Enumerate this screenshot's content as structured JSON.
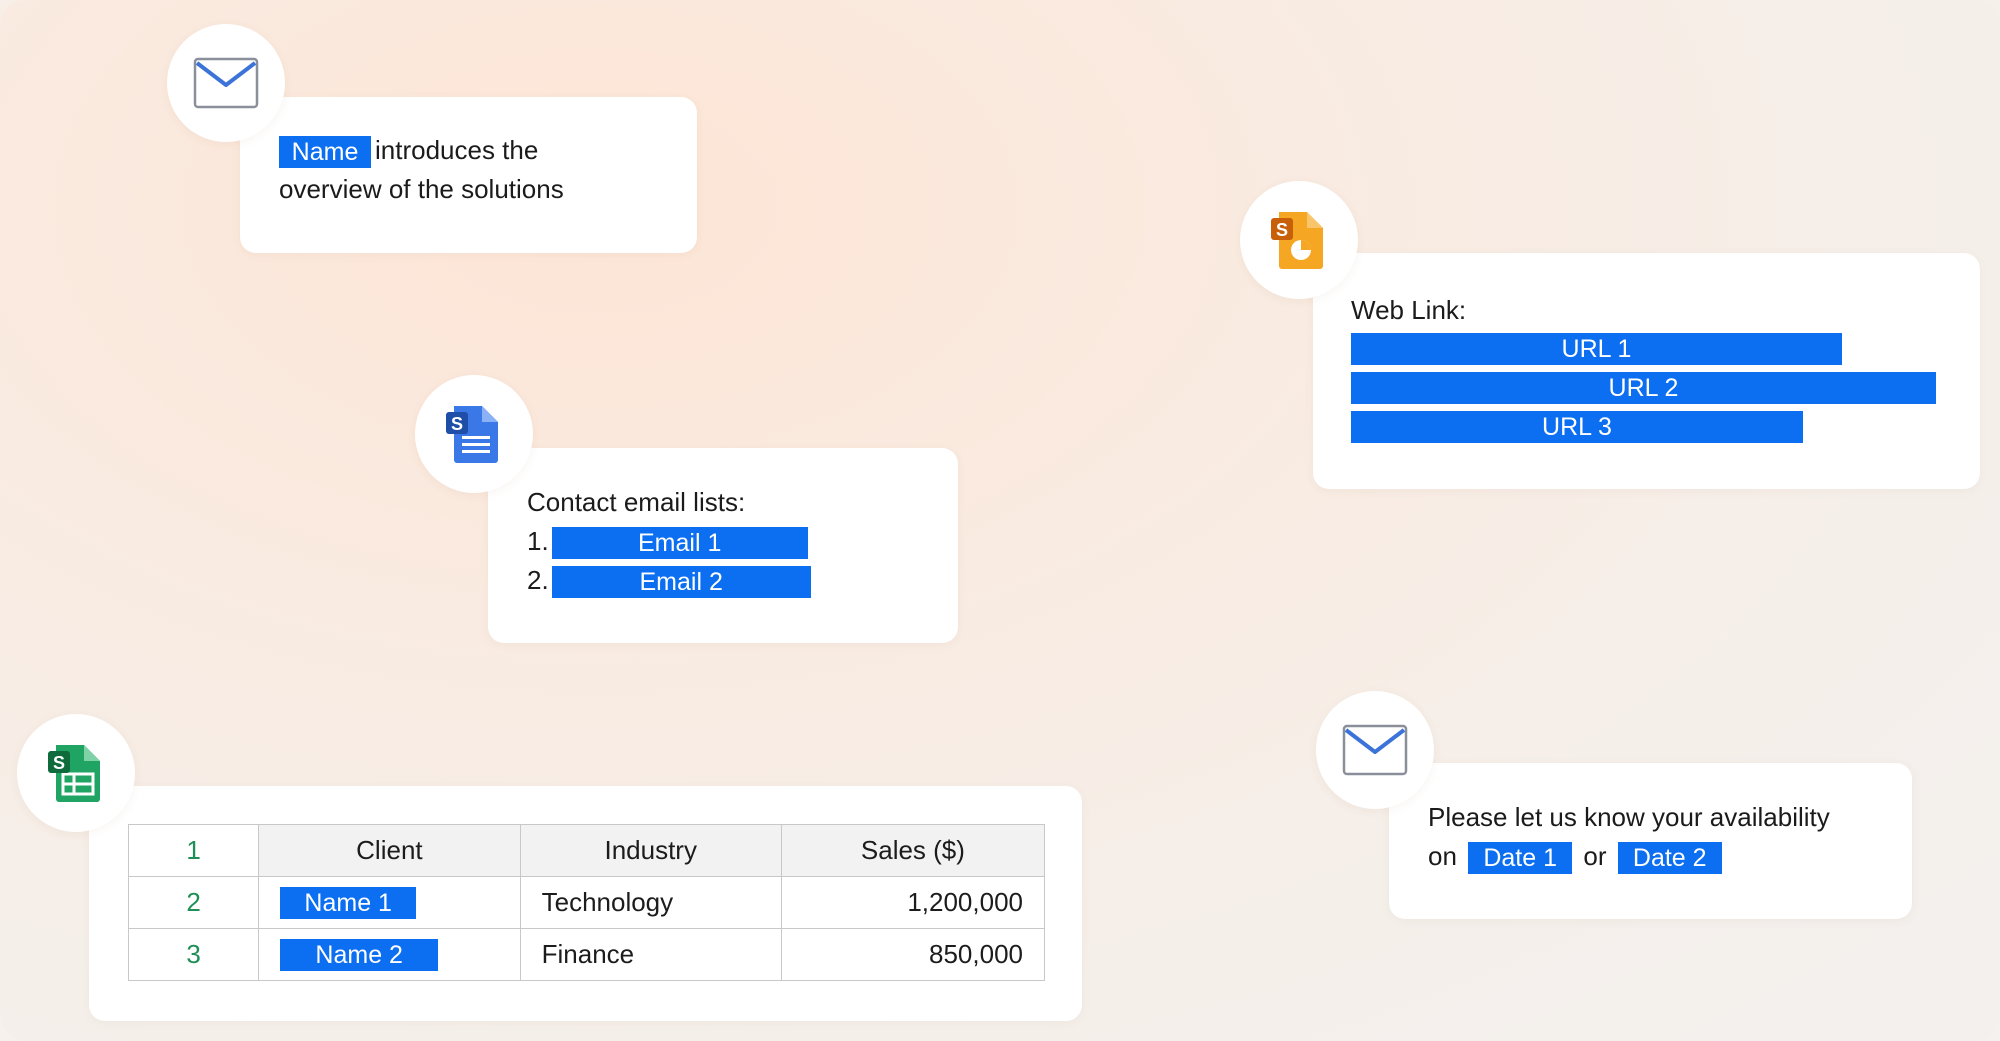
{
  "card_intro": {
    "highlight": "Name",
    "text_line1": "introduces the",
    "text_line2": "overview of the solutions"
  },
  "card_web": {
    "label": "Web Link:",
    "links": [
      "URL 1",
      "URL 2",
      "URL 3"
    ]
  },
  "card_contacts": {
    "label": "Contact email lists:",
    "items": [
      {
        "number": "1.",
        "value": "Email 1"
      },
      {
        "number": "2.",
        "value": "Email 2"
      }
    ]
  },
  "card_sheet": {
    "header_rownum": "1",
    "columns": [
      "Client",
      "Industry",
      "Sales ($)"
    ],
    "rows": [
      {
        "rownum": "2",
        "client": "Name 1",
        "industry": "Technology",
        "sales": "1,200,000"
      },
      {
        "rownum": "3",
        "client": "Name 2",
        "industry": "Finance",
        "sales": "850,000"
      }
    ]
  },
  "card_availability": {
    "line1": "Please let us know your availability",
    "on": "on",
    "date1": "Date 1",
    "or": "or",
    "date2": "Date 2"
  },
  "icons": {
    "mail": "mail-icon",
    "slides": "slides-icon",
    "docs": "docs-icon",
    "sheets": "sheets-icon"
  },
  "colors": {
    "highlight": "#0c6ef0",
    "mail_blue": "#3b73d9",
    "slides_orange": "#f5a623",
    "docs_blue": "#3b78e7",
    "sheets_green": "#1fa463",
    "badge_letter_bg": "#1e4ea8"
  }
}
